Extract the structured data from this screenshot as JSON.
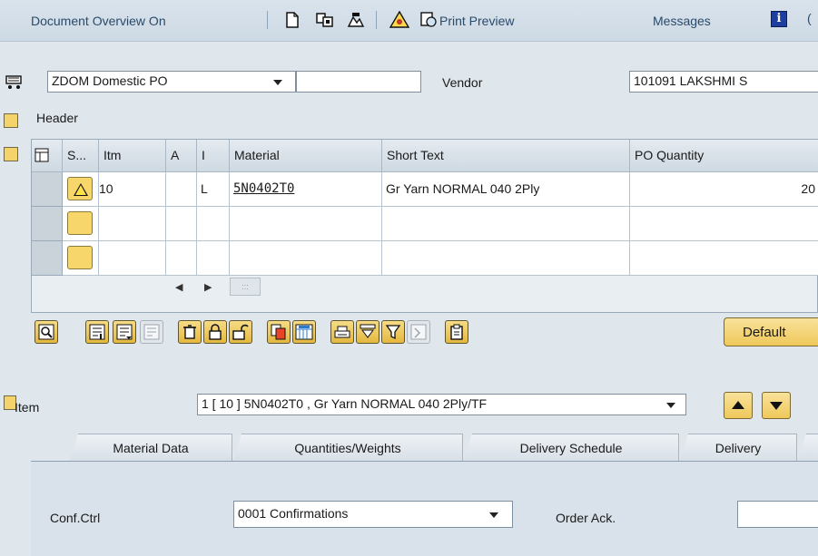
{
  "toolbar": {
    "doc_overview": "Document Overview On",
    "print_preview": "Print Preview",
    "messages": "Messages",
    "icons": [
      "new-document-icon",
      "copy-icon",
      "hierarchy-icon",
      "check-icon",
      "print-preview-icon",
      "info-icon"
    ]
  },
  "header": {
    "order_type": "ZDOM Domestic PO",
    "po_number": "",
    "vendor_label": "Vendor",
    "vendor_value": "101091 LAKSHMI S",
    "header_label": "Header"
  },
  "table": {
    "columns": [
      "S...",
      "Itm",
      "A",
      "I",
      "Material",
      "Short Text",
      "PO Quantity"
    ],
    "rows": [
      {
        "status": "warning",
        "itm": "10",
        "a": "",
        "i": "L",
        "material": "5N0402T0",
        "short_text": "Gr Yarn  NORMAL 040 2Ply",
        "po_qty": "20"
      },
      {
        "status": "empty",
        "itm": "",
        "a": "",
        "i": "",
        "material": "",
        "short_text": "",
        "po_qty": ""
      },
      {
        "status": "empty",
        "itm": "",
        "a": "",
        "i": "",
        "material": "",
        "short_text": "",
        "po_qty": ""
      }
    ]
  },
  "buttons": {
    "default_label": "Default"
  },
  "item": {
    "label": "Item",
    "selected": "1 [ 10 ] 5N0402T0 , Gr Yarn  NORMAL 040 2Ply/TF"
  },
  "tabs": [
    "Material Data",
    "Quantities/Weights",
    "Delivery Schedule",
    "Delivery"
  ],
  "conf": {
    "label": "Conf.Ctrl",
    "value": "0001 Confirmations",
    "order_ack_label": "Order Ack.",
    "order_ack_value": ""
  },
  "colors": {
    "accent_yellow": "#f3d36a",
    "header_text": "#2a4a6a",
    "background": "#dfe6ec"
  }
}
